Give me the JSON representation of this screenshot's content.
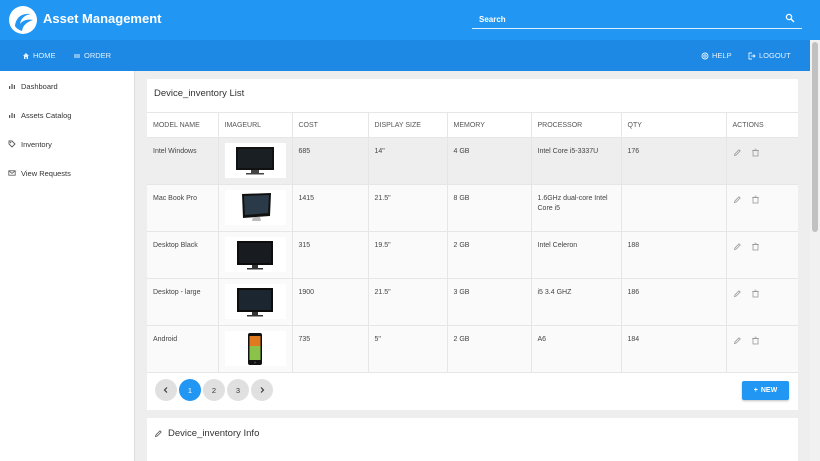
{
  "app": {
    "title": "Asset Management"
  },
  "search": {
    "placeholder": "Search"
  },
  "nav": {
    "home": "HOME",
    "order": "ORDER",
    "help": "HELP",
    "logout": "LOGOUT"
  },
  "sidebar": {
    "items": [
      {
        "label": "Dashboard",
        "icon": "bar-chart-icon"
      },
      {
        "label": "Assets Catalog",
        "icon": "bar-chart-icon"
      },
      {
        "label": "Inventory",
        "icon": "tag-icon"
      },
      {
        "label": "View Requests",
        "icon": "envelope-icon"
      }
    ]
  },
  "list": {
    "title": "Device_inventory List",
    "columns": [
      "MODEL NAME",
      "IMAGEURL",
      "COST",
      "DISPLAY SIZE",
      "MEMORY",
      "PROCESSOR",
      "QTY",
      "ACTIONS"
    ],
    "rows": [
      {
        "model": "Intel Windows",
        "image": "monitor-thumbnail",
        "cost": "685",
        "display": "14\"",
        "memory": "4 GB",
        "processor": "Intel Core i5-3337U",
        "qty": "176"
      },
      {
        "model": "Mac Book Pro",
        "image": "imac-thumbnail",
        "cost": "1415",
        "display": "21.5\"",
        "memory": "8 GB",
        "processor": "1.6GHz dual-core Intel Core i5",
        "qty": ""
      },
      {
        "model": "Desktop Black",
        "image": "monitor-thumbnail",
        "cost": "315",
        "display": "19.5\"",
        "memory": "2 GB",
        "processor": "Intel Celeron",
        "qty": "188"
      },
      {
        "model": "Desktop - large",
        "image": "monitor-thumbnail",
        "cost": "1900",
        "display": "21.5\"",
        "memory": "3 GB",
        "processor": "i5 3.4 GHZ",
        "qty": "186"
      },
      {
        "model": "Android",
        "image": "phone-thumbnail",
        "cost": "735",
        "display": "5\"",
        "memory": "2 GB",
        "processor": "A6",
        "qty": "184"
      }
    ]
  },
  "pagination": {
    "pages": [
      "1",
      "2",
      "3"
    ],
    "current": "1"
  },
  "actions": {
    "new_label": "NEW"
  },
  "info": {
    "title": "Device_inventory Info"
  },
  "colors": {
    "primary": "#2196f3",
    "navbar": "#1e88e5",
    "background": "#eeeeee"
  }
}
